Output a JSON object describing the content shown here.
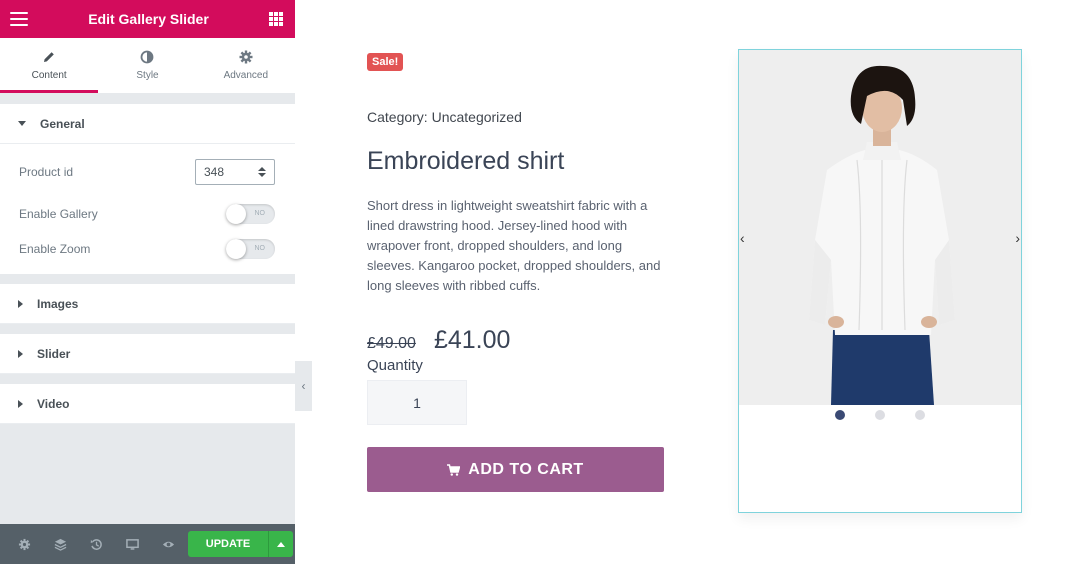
{
  "panel": {
    "title": "Edit Gallery Slider",
    "tabs": [
      {
        "label": "Content",
        "icon": "pencil-icon",
        "active": true
      },
      {
        "label": "Style",
        "icon": "contrast-icon",
        "active": false
      },
      {
        "label": "Advanced",
        "icon": "gear-icon",
        "active": false
      }
    ],
    "sections": {
      "general": {
        "label": "General",
        "expanded": true,
        "product_id_label": "Product id",
        "product_id_value": "348",
        "enable_gallery_label": "Enable Gallery",
        "enable_gallery_state": "NO",
        "enable_zoom_label": "Enable Zoom",
        "enable_zoom_state": "NO"
      },
      "images": {
        "label": "Images"
      },
      "slider": {
        "label": "Slider"
      },
      "video": {
        "label": "Video"
      }
    },
    "footer": {
      "icons": [
        "settings-icon",
        "navigator-icon",
        "history-icon",
        "responsive-icon",
        "preview-icon"
      ],
      "update_label": "UPDATE"
    }
  },
  "product": {
    "sale_badge": "Sale!",
    "category": "Category: Uncategorized",
    "title": "Embroidered shirt",
    "description": "Short dress in lightweight sweatshirt fabric with a lined drawstring hood. Jersey-lined hood with wrapover front, dropped shoulders, and long sleeves. Kangaroo pocket, dropped shoulders, and long sleeves with ribbed cuffs.",
    "old_price": "£49.00",
    "new_price": "£41.00",
    "quantity_label": "Quantity",
    "quantity_value": "1",
    "add_to_cart_label": "ADD TO CART"
  },
  "gallery": {
    "dot_count": 3,
    "active_dot": 1,
    "prev_arrow": "‹",
    "next_arrow": "›"
  },
  "colors": {
    "brand": "#d30c5c",
    "update_green": "#39b54a",
    "cart_purple": "#9b5c8f",
    "sale_red": "#e25353"
  }
}
